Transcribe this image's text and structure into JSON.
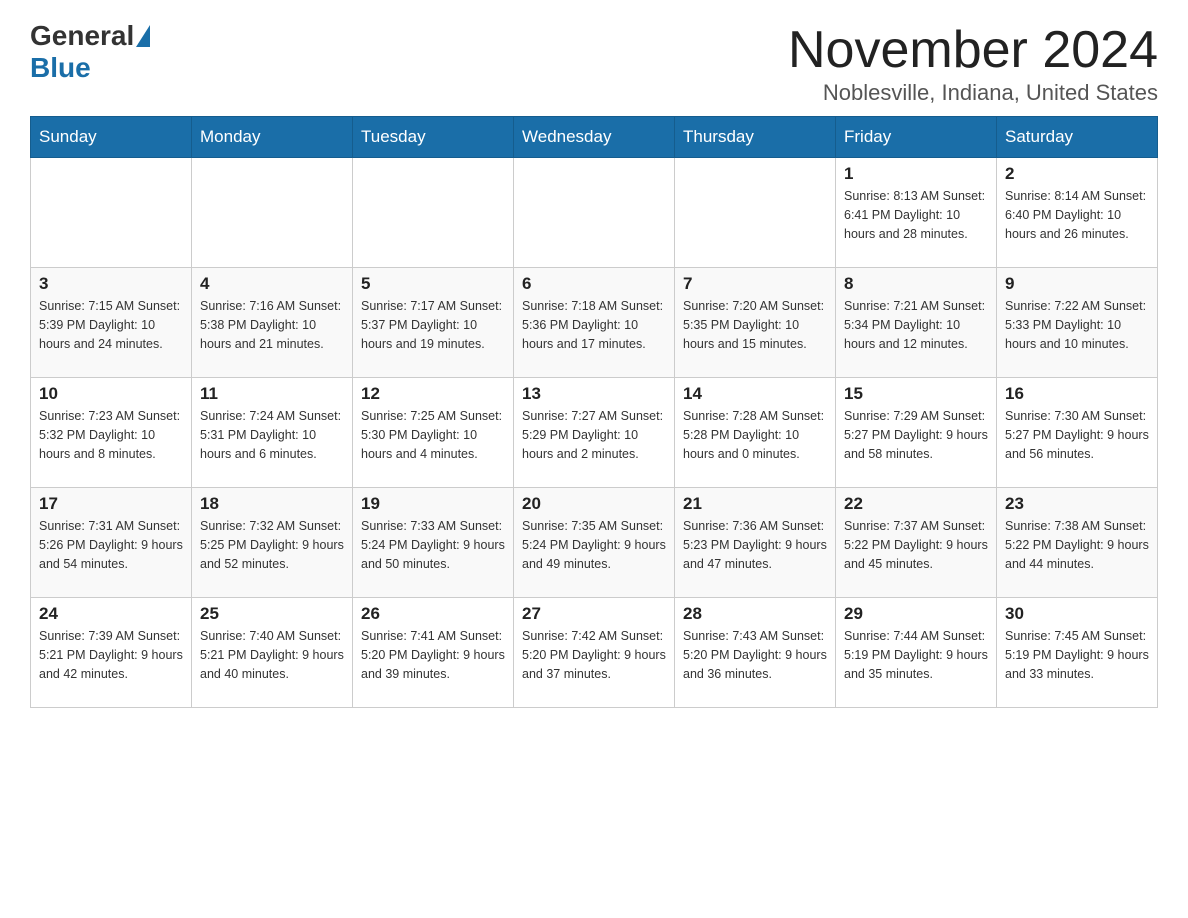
{
  "header": {
    "logo_general": "General",
    "logo_blue": "Blue",
    "month_title": "November 2024",
    "location": "Noblesville, Indiana, United States"
  },
  "days_of_week": [
    "Sunday",
    "Monday",
    "Tuesday",
    "Wednesday",
    "Thursday",
    "Friday",
    "Saturday"
  ],
  "weeks": [
    [
      {
        "day": "",
        "info": ""
      },
      {
        "day": "",
        "info": ""
      },
      {
        "day": "",
        "info": ""
      },
      {
        "day": "",
        "info": ""
      },
      {
        "day": "",
        "info": ""
      },
      {
        "day": "1",
        "info": "Sunrise: 8:13 AM\nSunset: 6:41 PM\nDaylight: 10 hours and 28 minutes."
      },
      {
        "day": "2",
        "info": "Sunrise: 8:14 AM\nSunset: 6:40 PM\nDaylight: 10 hours and 26 minutes."
      }
    ],
    [
      {
        "day": "3",
        "info": "Sunrise: 7:15 AM\nSunset: 5:39 PM\nDaylight: 10 hours and 24 minutes."
      },
      {
        "day": "4",
        "info": "Sunrise: 7:16 AM\nSunset: 5:38 PM\nDaylight: 10 hours and 21 minutes."
      },
      {
        "day": "5",
        "info": "Sunrise: 7:17 AM\nSunset: 5:37 PM\nDaylight: 10 hours and 19 minutes."
      },
      {
        "day": "6",
        "info": "Sunrise: 7:18 AM\nSunset: 5:36 PM\nDaylight: 10 hours and 17 minutes."
      },
      {
        "day": "7",
        "info": "Sunrise: 7:20 AM\nSunset: 5:35 PM\nDaylight: 10 hours and 15 minutes."
      },
      {
        "day": "8",
        "info": "Sunrise: 7:21 AM\nSunset: 5:34 PM\nDaylight: 10 hours and 12 minutes."
      },
      {
        "day": "9",
        "info": "Sunrise: 7:22 AM\nSunset: 5:33 PM\nDaylight: 10 hours and 10 minutes."
      }
    ],
    [
      {
        "day": "10",
        "info": "Sunrise: 7:23 AM\nSunset: 5:32 PM\nDaylight: 10 hours and 8 minutes."
      },
      {
        "day": "11",
        "info": "Sunrise: 7:24 AM\nSunset: 5:31 PM\nDaylight: 10 hours and 6 minutes."
      },
      {
        "day": "12",
        "info": "Sunrise: 7:25 AM\nSunset: 5:30 PM\nDaylight: 10 hours and 4 minutes."
      },
      {
        "day": "13",
        "info": "Sunrise: 7:27 AM\nSunset: 5:29 PM\nDaylight: 10 hours and 2 minutes."
      },
      {
        "day": "14",
        "info": "Sunrise: 7:28 AM\nSunset: 5:28 PM\nDaylight: 10 hours and 0 minutes."
      },
      {
        "day": "15",
        "info": "Sunrise: 7:29 AM\nSunset: 5:27 PM\nDaylight: 9 hours and 58 minutes."
      },
      {
        "day": "16",
        "info": "Sunrise: 7:30 AM\nSunset: 5:27 PM\nDaylight: 9 hours and 56 minutes."
      }
    ],
    [
      {
        "day": "17",
        "info": "Sunrise: 7:31 AM\nSunset: 5:26 PM\nDaylight: 9 hours and 54 minutes."
      },
      {
        "day": "18",
        "info": "Sunrise: 7:32 AM\nSunset: 5:25 PM\nDaylight: 9 hours and 52 minutes."
      },
      {
        "day": "19",
        "info": "Sunrise: 7:33 AM\nSunset: 5:24 PM\nDaylight: 9 hours and 50 minutes."
      },
      {
        "day": "20",
        "info": "Sunrise: 7:35 AM\nSunset: 5:24 PM\nDaylight: 9 hours and 49 minutes."
      },
      {
        "day": "21",
        "info": "Sunrise: 7:36 AM\nSunset: 5:23 PM\nDaylight: 9 hours and 47 minutes."
      },
      {
        "day": "22",
        "info": "Sunrise: 7:37 AM\nSunset: 5:22 PM\nDaylight: 9 hours and 45 minutes."
      },
      {
        "day": "23",
        "info": "Sunrise: 7:38 AM\nSunset: 5:22 PM\nDaylight: 9 hours and 44 minutes."
      }
    ],
    [
      {
        "day": "24",
        "info": "Sunrise: 7:39 AM\nSunset: 5:21 PM\nDaylight: 9 hours and 42 minutes."
      },
      {
        "day": "25",
        "info": "Sunrise: 7:40 AM\nSunset: 5:21 PM\nDaylight: 9 hours and 40 minutes."
      },
      {
        "day": "26",
        "info": "Sunrise: 7:41 AM\nSunset: 5:20 PM\nDaylight: 9 hours and 39 minutes."
      },
      {
        "day": "27",
        "info": "Sunrise: 7:42 AM\nSunset: 5:20 PM\nDaylight: 9 hours and 37 minutes."
      },
      {
        "day": "28",
        "info": "Sunrise: 7:43 AM\nSunset: 5:20 PM\nDaylight: 9 hours and 36 minutes."
      },
      {
        "day": "29",
        "info": "Sunrise: 7:44 AM\nSunset: 5:19 PM\nDaylight: 9 hours and 35 minutes."
      },
      {
        "day": "30",
        "info": "Sunrise: 7:45 AM\nSunset: 5:19 PM\nDaylight: 9 hours and 33 minutes."
      }
    ]
  ]
}
